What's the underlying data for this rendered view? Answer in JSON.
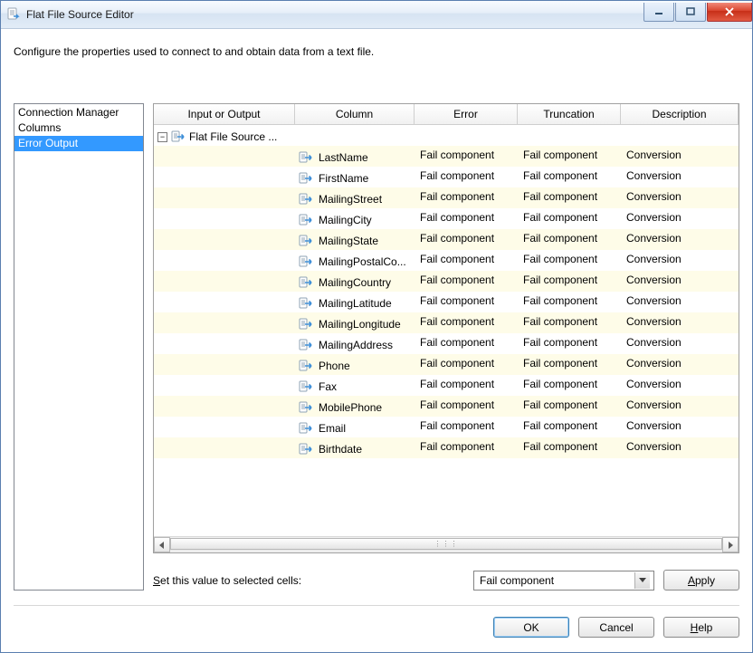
{
  "window": {
    "title": "Flat File Source Editor"
  },
  "instruction": "Configure the properties used to connect to and obtain data from a text file.",
  "sidebar": {
    "items": [
      {
        "label": "Connection Manager",
        "selected": false
      },
      {
        "label": "Columns",
        "selected": false
      },
      {
        "label": "Error Output",
        "selected": true
      }
    ]
  },
  "grid": {
    "headers": {
      "input_output": "Input or Output",
      "column": "Column",
      "error": "Error",
      "truncation": "Truncation",
      "description": "Description"
    },
    "source_label": "Flat File Source ...",
    "rows": [
      {
        "column": "LastName",
        "error": "Fail component",
        "truncation": "Fail component",
        "description": "Conversion"
      },
      {
        "column": "FirstName",
        "error": "Fail component",
        "truncation": "Fail component",
        "description": "Conversion"
      },
      {
        "column": "MailingStreet",
        "error": "Fail component",
        "truncation": "Fail component",
        "description": "Conversion"
      },
      {
        "column": "MailingCity",
        "error": "Fail component",
        "truncation": "Fail component",
        "description": "Conversion"
      },
      {
        "column": "MailingState",
        "error": "Fail component",
        "truncation": "Fail component",
        "description": "Conversion"
      },
      {
        "column": "MailingPostalCo...",
        "error": "Fail component",
        "truncation": "Fail component",
        "description": "Conversion"
      },
      {
        "column": "MailingCountry",
        "error": "Fail component",
        "truncation": "Fail component",
        "description": "Conversion"
      },
      {
        "column": "MailingLatitude",
        "error": "Fail component",
        "truncation": "Fail component",
        "description": "Conversion"
      },
      {
        "column": "MailingLongitude",
        "error": "Fail component",
        "truncation": "Fail component",
        "description": "Conversion"
      },
      {
        "column": "MailingAddress",
        "error": "Fail component",
        "truncation": "Fail component",
        "description": "Conversion"
      },
      {
        "column": "Phone",
        "error": "Fail component",
        "truncation": "Fail component",
        "description": "Conversion"
      },
      {
        "column": "Fax",
        "error": "Fail component",
        "truncation": "Fail component",
        "description": "Conversion"
      },
      {
        "column": "MobilePhone",
        "error": "Fail component",
        "truncation": "Fail component",
        "description": "Conversion"
      },
      {
        "column": "Email",
        "error": "Fail component",
        "truncation": "Fail component",
        "description": "Conversion"
      },
      {
        "column": "Birthdate",
        "error": "Fail component",
        "truncation": "Fail component",
        "description": "Conversion"
      }
    ]
  },
  "set_row": {
    "label": "Set this value to selected cells:",
    "dropdown_value": "Fail component",
    "apply_label": "Apply"
  },
  "footer": {
    "ok": "OK",
    "cancel": "Cancel",
    "help": "Help"
  }
}
